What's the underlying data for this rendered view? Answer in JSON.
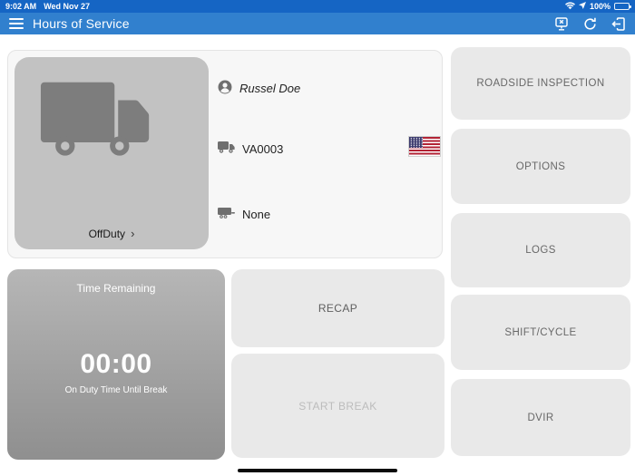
{
  "status_bar": {
    "time": "9:02 AM",
    "date": "Wed Nov 27",
    "battery_percent": "100%",
    "icons": [
      "wifi-icon",
      "location-arrow-icon",
      "battery-icon"
    ]
  },
  "nav_bar": {
    "title": "Hours of Service",
    "icons": [
      "menu-hamburger-icon",
      "device-disconnect-icon",
      "refresh-icon",
      "logout-icon"
    ]
  },
  "driver_card": {
    "duty_status": "OffDuty",
    "chevron": "›",
    "driver_name": "Russel Doe",
    "vehicle_id": "VA0003",
    "trailer": "None",
    "flag": "us-flag",
    "icons": [
      "truck-large-icon",
      "person-icon",
      "truck-small-icon",
      "trailer-icon"
    ]
  },
  "time_panel": {
    "title": "Time Remaining",
    "value": "00:00",
    "subtitle": "On Duty Time Until Break"
  },
  "actions": {
    "recap": "RECAP",
    "start_break": "START BREAK"
  },
  "menu_buttons": [
    {
      "label": "ROADSIDE INSPECTION"
    },
    {
      "label": "OPTIONS"
    },
    {
      "label": "LOGS"
    },
    {
      "label": "SHIFT/CYCLE"
    },
    {
      "label": "DVIR"
    }
  ],
  "colors": {
    "status_bar_blue": "#1565c4",
    "nav_bar_blue": "#3180ce",
    "tile_grey": "#c2c2c2",
    "truck_icon_grey": "#7d7d7d",
    "button_grey": "#e9e9e9",
    "panel_gradient_top": "#b6b6b6",
    "panel_gradient_bottom": "#8f8f8f"
  }
}
